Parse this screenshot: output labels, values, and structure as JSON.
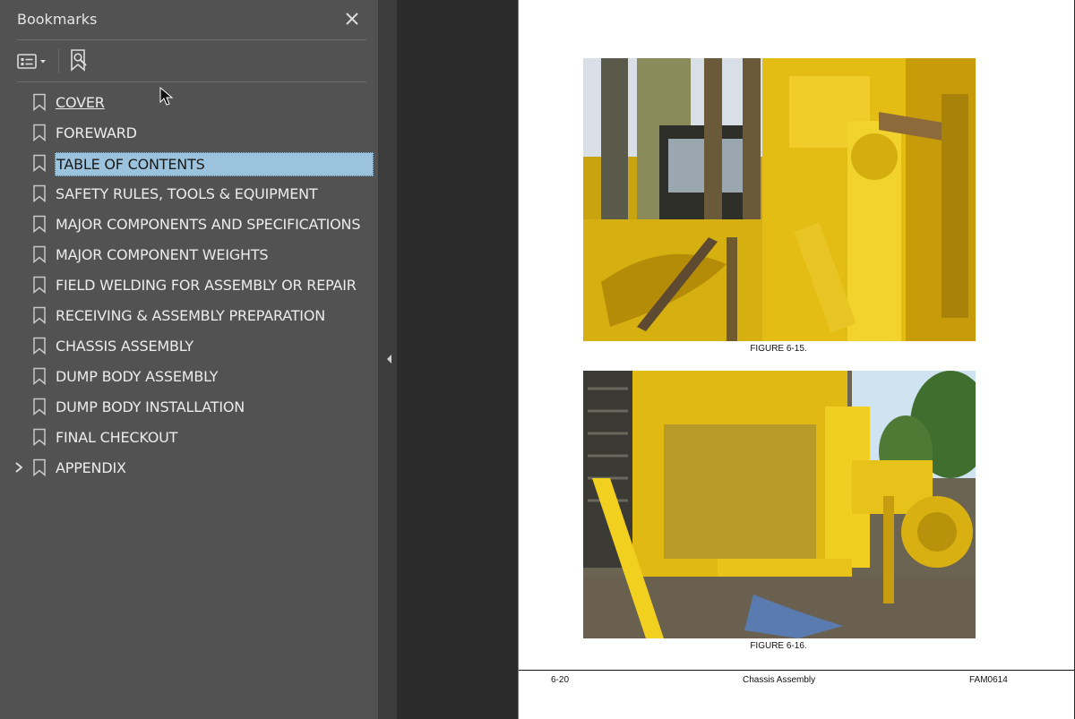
{
  "sidebar": {
    "title": "Bookmarks",
    "close_icon": "close-icon",
    "toolbar": {
      "options_icon": "bookmark-options-icon",
      "find_icon": "find-current-bookmark-icon"
    },
    "items": [
      {
        "label": "COVER",
        "state": "underlined"
      },
      {
        "label": "FOREWARD"
      },
      {
        "label": "TABLE OF CONTENTS",
        "state": "selected"
      },
      {
        "label": "SAFETY RULES, TOOLS & EQUIPMENT"
      },
      {
        "label": "MAJOR COMPONENTS AND SPECIFICATIONS"
      },
      {
        "label": "MAJOR COMPONENT WEIGHTS"
      },
      {
        "label": "FIELD WELDING FOR ASSEMBLY OR REPAIR"
      },
      {
        "label": "RECEIVING & ASSEMBLY PREPARATION"
      },
      {
        "label": "CHASSIS ASSEMBLY"
      },
      {
        "label": "DUMP BODY ASSEMBLY"
      },
      {
        "label": "DUMP BODY INSTALLATION"
      },
      {
        "label": "FINAL CHECKOUT"
      },
      {
        "label": "APPENDIX",
        "expandable": true
      }
    ]
  },
  "document": {
    "figures": [
      {
        "caption": "FIGURE 6-15."
      },
      {
        "caption": "FIGURE 6-16."
      }
    ],
    "footer": {
      "page": "6-20",
      "section": "Chassis Assembly",
      "doc_id": "FAM0614"
    }
  },
  "colors": {
    "sidebar_bg": "#525252",
    "selection": "#9cc3dd",
    "machine_yellow": "#e8c21a",
    "viewer_bg": "#2b2b2b"
  }
}
